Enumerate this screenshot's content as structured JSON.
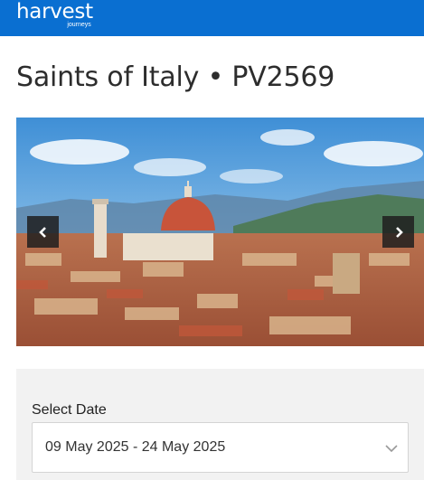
{
  "header": {
    "brand": "harvest",
    "brand_sub": "journeys",
    "brand_color": "#0a6fd1"
  },
  "page": {
    "title": "Saints of Italy • PV2569"
  },
  "carousel": {
    "prev_icon": "chevron-left-icon",
    "next_icon": "chevron-right-icon"
  },
  "booking": {
    "date_label": "Select Date",
    "date_value": "09 May 2025 - 24 May 2025",
    "dropdown_icon": "chevron-down-icon"
  }
}
